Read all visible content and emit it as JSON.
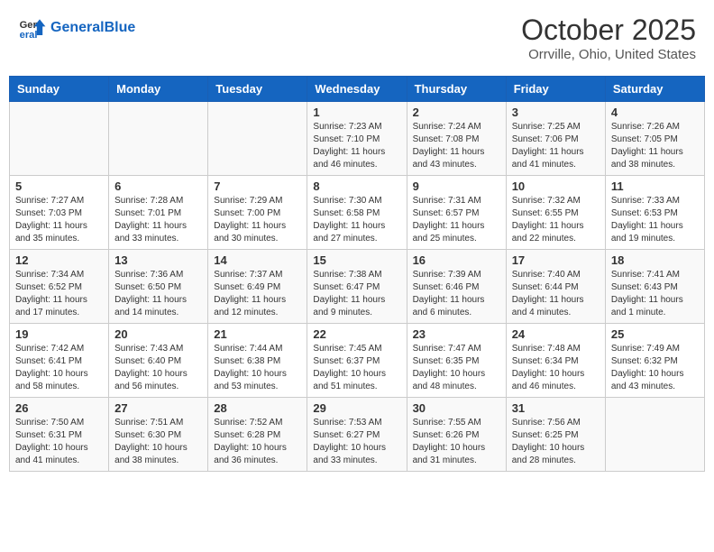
{
  "header": {
    "logo_line1": "General",
    "logo_line2": "Blue",
    "month": "October 2025",
    "location": "Orrville, Ohio, United States"
  },
  "days_of_week": [
    "Sunday",
    "Monday",
    "Tuesday",
    "Wednesday",
    "Thursday",
    "Friday",
    "Saturday"
  ],
  "weeks": [
    [
      {
        "day": "",
        "info": ""
      },
      {
        "day": "",
        "info": ""
      },
      {
        "day": "",
        "info": ""
      },
      {
        "day": "1",
        "info": "Sunrise: 7:23 AM\nSunset: 7:10 PM\nDaylight: 11 hours and 46 minutes."
      },
      {
        "day": "2",
        "info": "Sunrise: 7:24 AM\nSunset: 7:08 PM\nDaylight: 11 hours and 43 minutes."
      },
      {
        "day": "3",
        "info": "Sunrise: 7:25 AM\nSunset: 7:06 PM\nDaylight: 11 hours and 41 minutes."
      },
      {
        "day": "4",
        "info": "Sunrise: 7:26 AM\nSunset: 7:05 PM\nDaylight: 11 hours and 38 minutes."
      }
    ],
    [
      {
        "day": "5",
        "info": "Sunrise: 7:27 AM\nSunset: 7:03 PM\nDaylight: 11 hours and 35 minutes."
      },
      {
        "day": "6",
        "info": "Sunrise: 7:28 AM\nSunset: 7:01 PM\nDaylight: 11 hours and 33 minutes."
      },
      {
        "day": "7",
        "info": "Sunrise: 7:29 AM\nSunset: 7:00 PM\nDaylight: 11 hours and 30 minutes."
      },
      {
        "day": "8",
        "info": "Sunrise: 7:30 AM\nSunset: 6:58 PM\nDaylight: 11 hours and 27 minutes."
      },
      {
        "day": "9",
        "info": "Sunrise: 7:31 AM\nSunset: 6:57 PM\nDaylight: 11 hours and 25 minutes."
      },
      {
        "day": "10",
        "info": "Sunrise: 7:32 AM\nSunset: 6:55 PM\nDaylight: 11 hours and 22 minutes."
      },
      {
        "day": "11",
        "info": "Sunrise: 7:33 AM\nSunset: 6:53 PM\nDaylight: 11 hours and 19 minutes."
      }
    ],
    [
      {
        "day": "12",
        "info": "Sunrise: 7:34 AM\nSunset: 6:52 PM\nDaylight: 11 hours and 17 minutes."
      },
      {
        "day": "13",
        "info": "Sunrise: 7:36 AM\nSunset: 6:50 PM\nDaylight: 11 hours and 14 minutes."
      },
      {
        "day": "14",
        "info": "Sunrise: 7:37 AM\nSunset: 6:49 PM\nDaylight: 11 hours and 12 minutes."
      },
      {
        "day": "15",
        "info": "Sunrise: 7:38 AM\nSunset: 6:47 PM\nDaylight: 11 hours and 9 minutes."
      },
      {
        "day": "16",
        "info": "Sunrise: 7:39 AM\nSunset: 6:46 PM\nDaylight: 11 hours and 6 minutes."
      },
      {
        "day": "17",
        "info": "Sunrise: 7:40 AM\nSunset: 6:44 PM\nDaylight: 11 hours and 4 minutes."
      },
      {
        "day": "18",
        "info": "Sunrise: 7:41 AM\nSunset: 6:43 PM\nDaylight: 11 hours and 1 minute."
      }
    ],
    [
      {
        "day": "19",
        "info": "Sunrise: 7:42 AM\nSunset: 6:41 PM\nDaylight: 10 hours and 58 minutes."
      },
      {
        "day": "20",
        "info": "Sunrise: 7:43 AM\nSunset: 6:40 PM\nDaylight: 10 hours and 56 minutes."
      },
      {
        "day": "21",
        "info": "Sunrise: 7:44 AM\nSunset: 6:38 PM\nDaylight: 10 hours and 53 minutes."
      },
      {
        "day": "22",
        "info": "Sunrise: 7:45 AM\nSunset: 6:37 PM\nDaylight: 10 hours and 51 minutes."
      },
      {
        "day": "23",
        "info": "Sunrise: 7:47 AM\nSunset: 6:35 PM\nDaylight: 10 hours and 48 minutes."
      },
      {
        "day": "24",
        "info": "Sunrise: 7:48 AM\nSunset: 6:34 PM\nDaylight: 10 hours and 46 minutes."
      },
      {
        "day": "25",
        "info": "Sunrise: 7:49 AM\nSunset: 6:32 PM\nDaylight: 10 hours and 43 minutes."
      }
    ],
    [
      {
        "day": "26",
        "info": "Sunrise: 7:50 AM\nSunset: 6:31 PM\nDaylight: 10 hours and 41 minutes."
      },
      {
        "day": "27",
        "info": "Sunrise: 7:51 AM\nSunset: 6:30 PM\nDaylight: 10 hours and 38 minutes."
      },
      {
        "day": "28",
        "info": "Sunrise: 7:52 AM\nSunset: 6:28 PM\nDaylight: 10 hours and 36 minutes."
      },
      {
        "day": "29",
        "info": "Sunrise: 7:53 AM\nSunset: 6:27 PM\nDaylight: 10 hours and 33 minutes."
      },
      {
        "day": "30",
        "info": "Sunrise: 7:55 AM\nSunset: 6:26 PM\nDaylight: 10 hours and 31 minutes."
      },
      {
        "day": "31",
        "info": "Sunrise: 7:56 AM\nSunset: 6:25 PM\nDaylight: 10 hours and 28 minutes."
      },
      {
        "day": "",
        "info": ""
      }
    ]
  ]
}
